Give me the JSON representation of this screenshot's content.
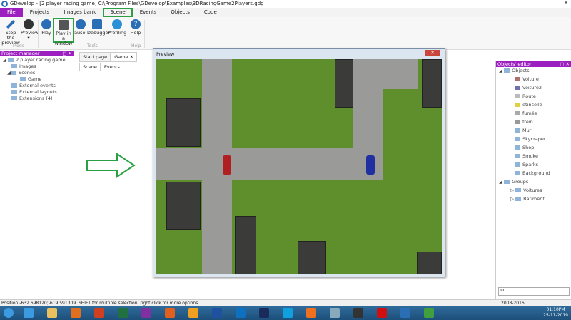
{
  "window": {
    "title": "GDevelop - [2 player racing game] C:\\Program Files\\GDevelop\\Examples\\3DRacingGame2Players.gdg"
  },
  "menu": [
    "File",
    "Projects",
    "Images bank",
    "Scene",
    "Events",
    "Objects",
    "Code"
  ],
  "ribbon": {
    "stop": "Stop the preview",
    "preview": "Preview",
    "play": "Play",
    "play_window": "Play in a window",
    "pause": "Pause",
    "debugger": "Debugger",
    "profiling": "Profiling",
    "help": "Help",
    "group_mode": "Mode",
    "group_tools": "Tools",
    "group_help": "Help"
  },
  "project_manager": {
    "title": "Project manager",
    "items": [
      "2 player racing game",
      "Images",
      "Scenes",
      "Game",
      "External events",
      "External layouts",
      "Extensions (4)"
    ]
  },
  "tabs": {
    "start": "Start page",
    "game": "Game",
    "scene": "Scene",
    "events": "Events"
  },
  "preview": {
    "title": "Preview"
  },
  "objects_editor": {
    "title": "Objects' editor",
    "objects_label": "Objects",
    "objects": [
      "Voiture",
      "Voiture2",
      "Route",
      "etincelle",
      "fumée",
      "frein",
      "Mur",
      "Skycraper",
      "Shop",
      "Smoke",
      "Sparks",
      "Background"
    ],
    "groups_label": "Groups",
    "groups": [
      "Voitures",
      "Batiment"
    ]
  },
  "status": {
    "text": "Position -632.698120;-619.591309. SHIFT for multiple selection, right click for more options.",
    "copyright": "2008-2016"
  },
  "taskbar": {
    "time": "01:10PM",
    "date": "25-11-2019"
  }
}
